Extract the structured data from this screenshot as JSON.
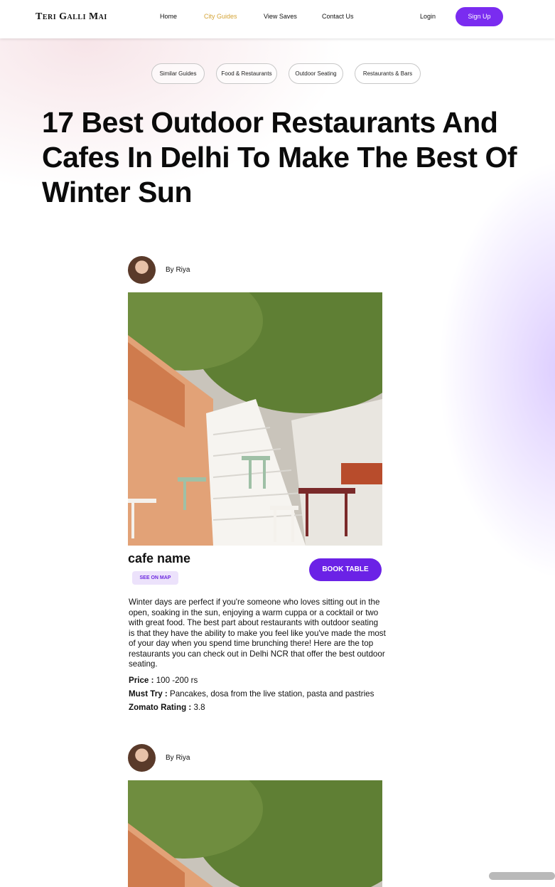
{
  "header": {
    "logo": "Teri Galli Mai",
    "nav": [
      {
        "label": "Home"
      },
      {
        "label": "City Guides",
        "active": true
      },
      {
        "label": "View Saves"
      },
      {
        "label": "Contact Us"
      }
    ],
    "login_label": "Login",
    "signup_label": "Sign Up"
  },
  "tags": [
    "Similar Guides",
    "Food & Restaurants",
    "Outdoor Seating",
    "Restaurants & Bars"
  ],
  "article": {
    "title": "17 Best Outdoor Restaurants And Cafes In Delhi To Make The Best Of Winter Sun"
  },
  "entries": [
    {
      "author": "By Riya",
      "cafe_name": "cafe name",
      "see_map_label": "SEE ON MAP",
      "book_label": "BOOK TABLE",
      "description": "Winter days are perfect if you're someone who loves sitting out in the open, soaking in the sun, enjoying a warm cuppa or a cocktail or two with great food. The best part about restaurants with outdoor seating is that they have the ability to make you feel like you've made the most of your day when you spend time brunching there! Here are the top restaurants you can check out in Delhi NCR that offer the best outdoor seating.",
      "price_label": "Price :",
      "price_value": "100 -200 rs",
      "must_try_label": "Must Try :",
      "must_try_value": "Pancakes, dosa from the live station, pasta and pastries",
      "rating_label": "Zomato Rating :",
      "rating_value": "3.8"
    },
    {
      "author": "By Riya"
    }
  ],
  "colors": {
    "accent": "#7a2cf0",
    "active_nav": "#d4a437",
    "map_badge_bg": "#ece2fb"
  },
  "icons": {
    "avatar": "avatar-photo",
    "cafe_photo": "cafe-street-photo"
  }
}
